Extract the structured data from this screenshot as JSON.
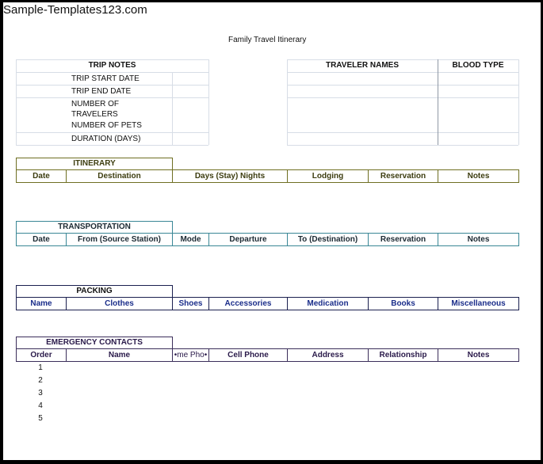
{
  "watermark": "Sample-Templates123.com",
  "document_title": "Family Travel Itinerary",
  "trip_notes": {
    "header": "TRIP NOTES",
    "rows": [
      "TRIP START DATE",
      "TRIP END DATE",
      "NUMBER OF TRAVELERS",
      "NUMBER OF PETS",
      "DURATION (DAYS)"
    ],
    "row_lines": {
      "start": "TRIP START DATE",
      "end": "TRIP END DATE",
      "travelers_1": "NUMBER OF",
      "travelers_2": "TRAVELERS",
      "pets": "NUMBER OF PETS",
      "duration": "DURATION (DAYS)"
    }
  },
  "travelers": {
    "names_header": "TRAVELER NAMES",
    "blood_type_header": "BLOOD TYPE"
  },
  "itinerary": {
    "title": "ITINERARY",
    "columns": [
      "Date",
      "Destination",
      "Days (Stay) Nights",
      "Lodging",
      "Reservation",
      "Notes"
    ]
  },
  "transportation": {
    "title": "TRANSPORTATION",
    "columns": [
      "Date",
      "From (Source Station)",
      "Mode",
      "Departure",
      "To (Destination)",
      "Reservation",
      "Notes"
    ]
  },
  "packing": {
    "title": "PACKING",
    "columns": [
      "Name",
      "Clothes",
      "Shoes",
      "Accessories",
      "Medication",
      "Books",
      "Miscellaneous"
    ]
  },
  "emergency_contacts": {
    "title": "EMERGENCY CONTACTS",
    "columns": [
      "Order",
      "Name",
      "Home Phone",
      "Cell Phone",
      "Address",
      "Relationship",
      "Notes"
    ],
    "columns_visible": [
      "Order",
      "Name",
      "•me Pho•",
      "Cell Phone",
      "Address",
      "Relationship",
      "Notes"
    ],
    "orders": [
      "1",
      "2",
      "3",
      "4",
      "5"
    ]
  },
  "colors": {
    "itinerary": "#6f6f22",
    "transportation": "#3a8796",
    "packing": "#1b2050",
    "packing_text": "#1a2d8a",
    "emergency": "#3b2e5a",
    "frame": "#000000"
  }
}
